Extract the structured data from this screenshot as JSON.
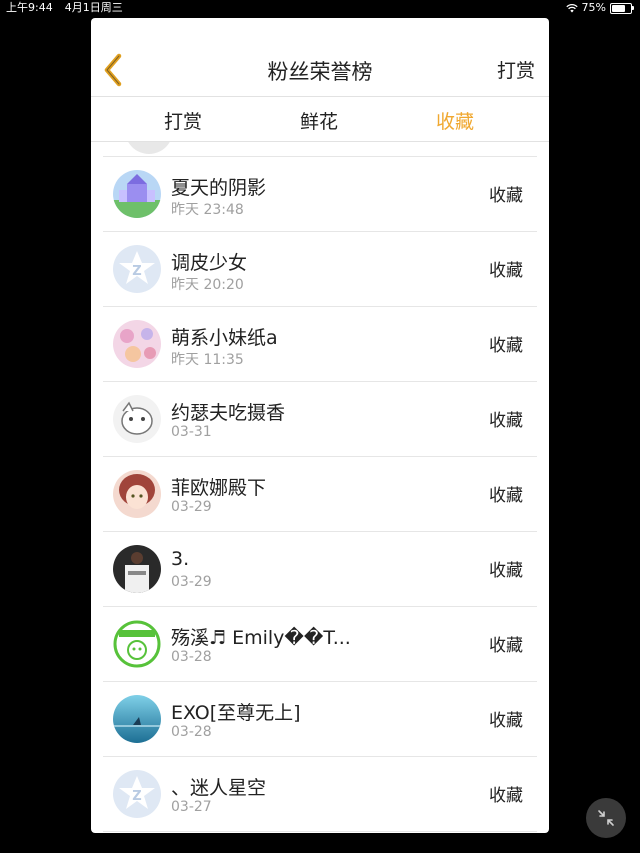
{
  "status_bar": {
    "time": "上午9:44",
    "date": "4月1日周三",
    "battery_text": "75%",
    "battery_level": 0.75
  },
  "header": {
    "title": "粉丝荣誉榜",
    "action_label": "打赏"
  },
  "tabs": [
    {
      "label": "打赏",
      "active": false
    },
    {
      "label": "鲜花",
      "active": false
    },
    {
      "label": "收藏",
      "active": true
    }
  ],
  "accent_color": "#f0a830",
  "fans": [
    {
      "name": "夏天的阴影",
      "time": "昨天 23:48",
      "action": "收藏",
      "avatar": "castle-avatar"
    },
    {
      "name": "调皮少女",
      "time": "昨天 20:20",
      "action": "收藏",
      "avatar": "default-avatar"
    },
    {
      "name": "萌系小妹纸a",
      "time": "昨天 11:35",
      "action": "收藏",
      "avatar": "floral-avatar"
    },
    {
      "name": "约瑟夫吃摄香",
      "time": "03-31",
      "action": "收藏",
      "avatar": "sketch-avatar"
    },
    {
      "name": "菲欧娜殿下",
      "time": "03-29",
      "action": "收藏",
      "avatar": "anime-avatar"
    },
    {
      "name": "3.",
      "time": "03-29",
      "action": "收藏",
      "avatar": "photo-avatar"
    },
    {
      "name": "殇溪♬ Emily��T...",
      "time": "03-28",
      "action": "收藏",
      "avatar": "green-badge-avatar"
    },
    {
      "name": "EXO[至尊无上]",
      "time": "03-28",
      "action": "收藏",
      "avatar": "ocean-avatar"
    },
    {
      "name": "、迷人星空",
      "time": "03-27",
      "action": "收藏",
      "avatar": "default-avatar"
    }
  ]
}
